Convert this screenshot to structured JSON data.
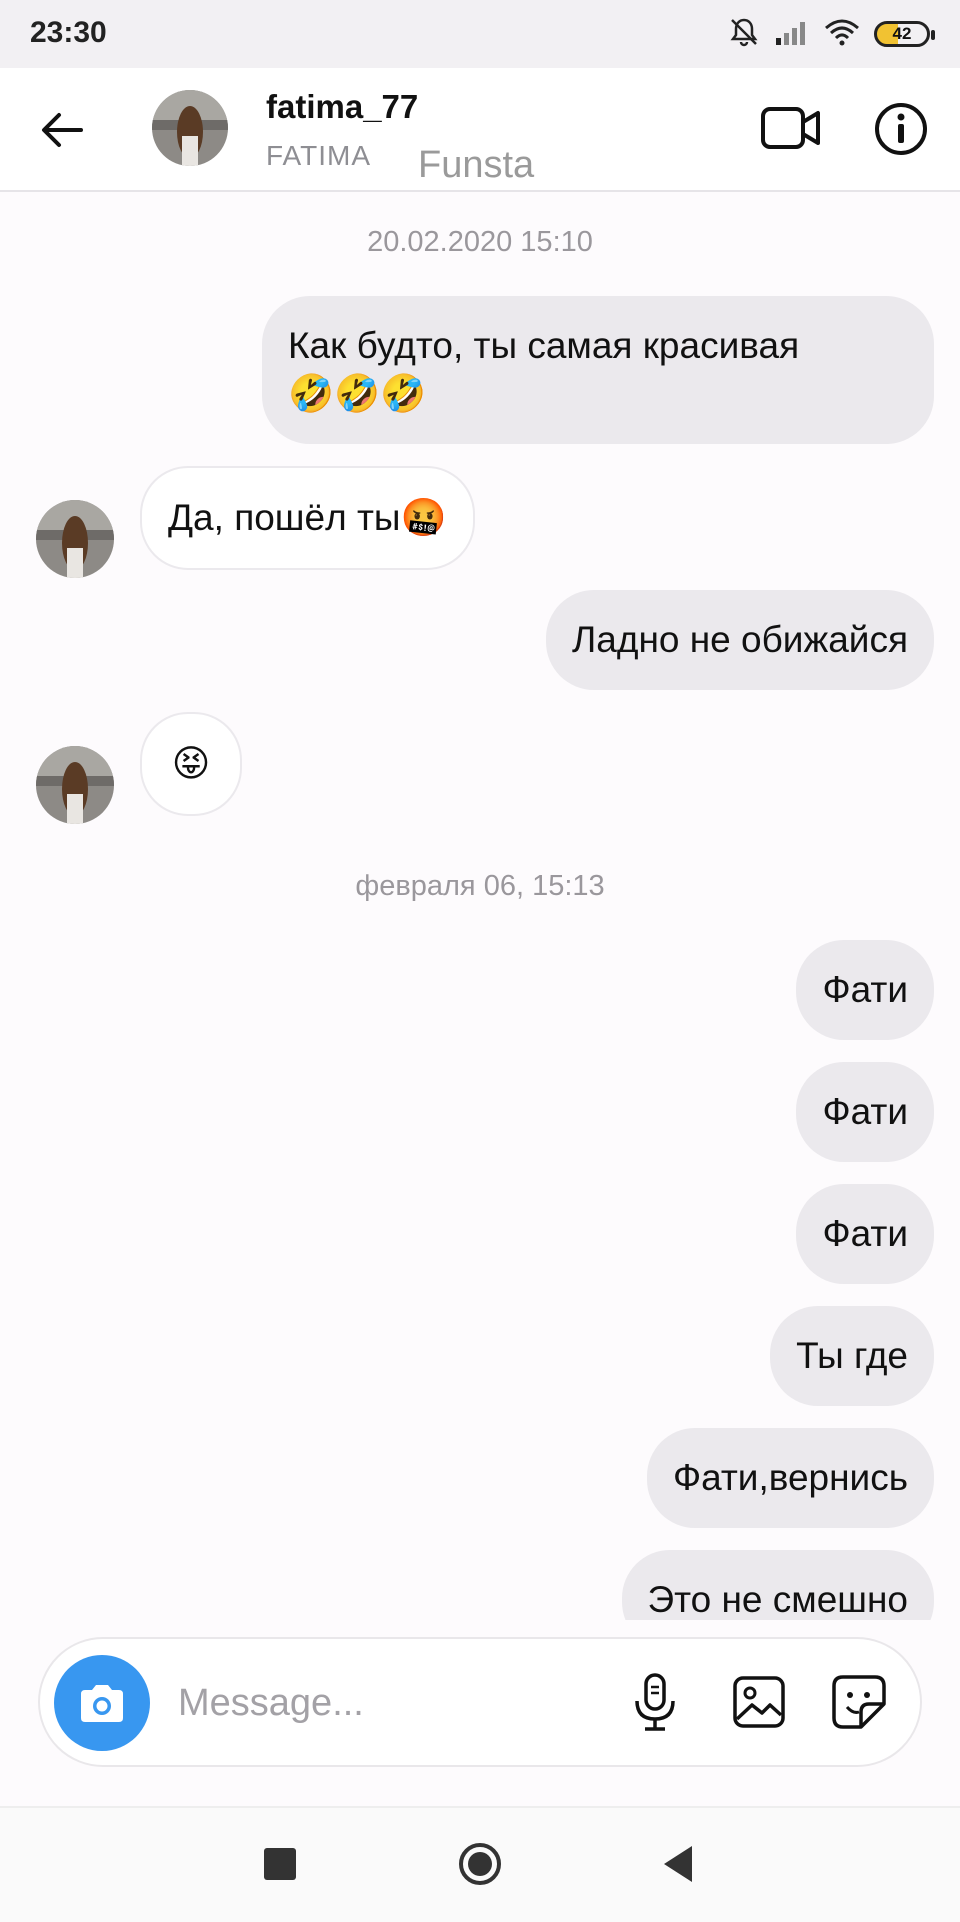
{
  "status_bar": {
    "time": "23:30",
    "battery": "42"
  },
  "header": {
    "username": "fatima_77",
    "full_name": "FATIMA",
    "overlay_label": "Funsta"
  },
  "thread": {
    "timestamps": [
      "20.02.2020 15:10",
      "февраля 06, 15:13"
    ],
    "messages": [
      {
        "dir": "out",
        "text": "Как будто, ты самая красивая\n🤣🤣🤣"
      },
      {
        "dir": "in",
        "text": "Да, пошёл ты🤬"
      },
      {
        "dir": "out",
        "text": "Ладно не обижайся"
      },
      {
        "dir": "in",
        "text": "😝"
      },
      {
        "dir": "out",
        "text": "Фати"
      },
      {
        "dir": "out",
        "text": "Фати"
      },
      {
        "dir": "out",
        "text": "Фати"
      },
      {
        "dir": "out",
        "text": "Ты где"
      },
      {
        "dir": "out",
        "text": "Фати,вернись"
      },
      {
        "dir": "out",
        "text": "Это не смешно"
      }
    ]
  },
  "composer": {
    "placeholder": "Message..."
  },
  "colors": {
    "accent": "#3897f0",
    "outgoing_bubble": "#ebe9ed",
    "background": "#fdfbfd"
  }
}
